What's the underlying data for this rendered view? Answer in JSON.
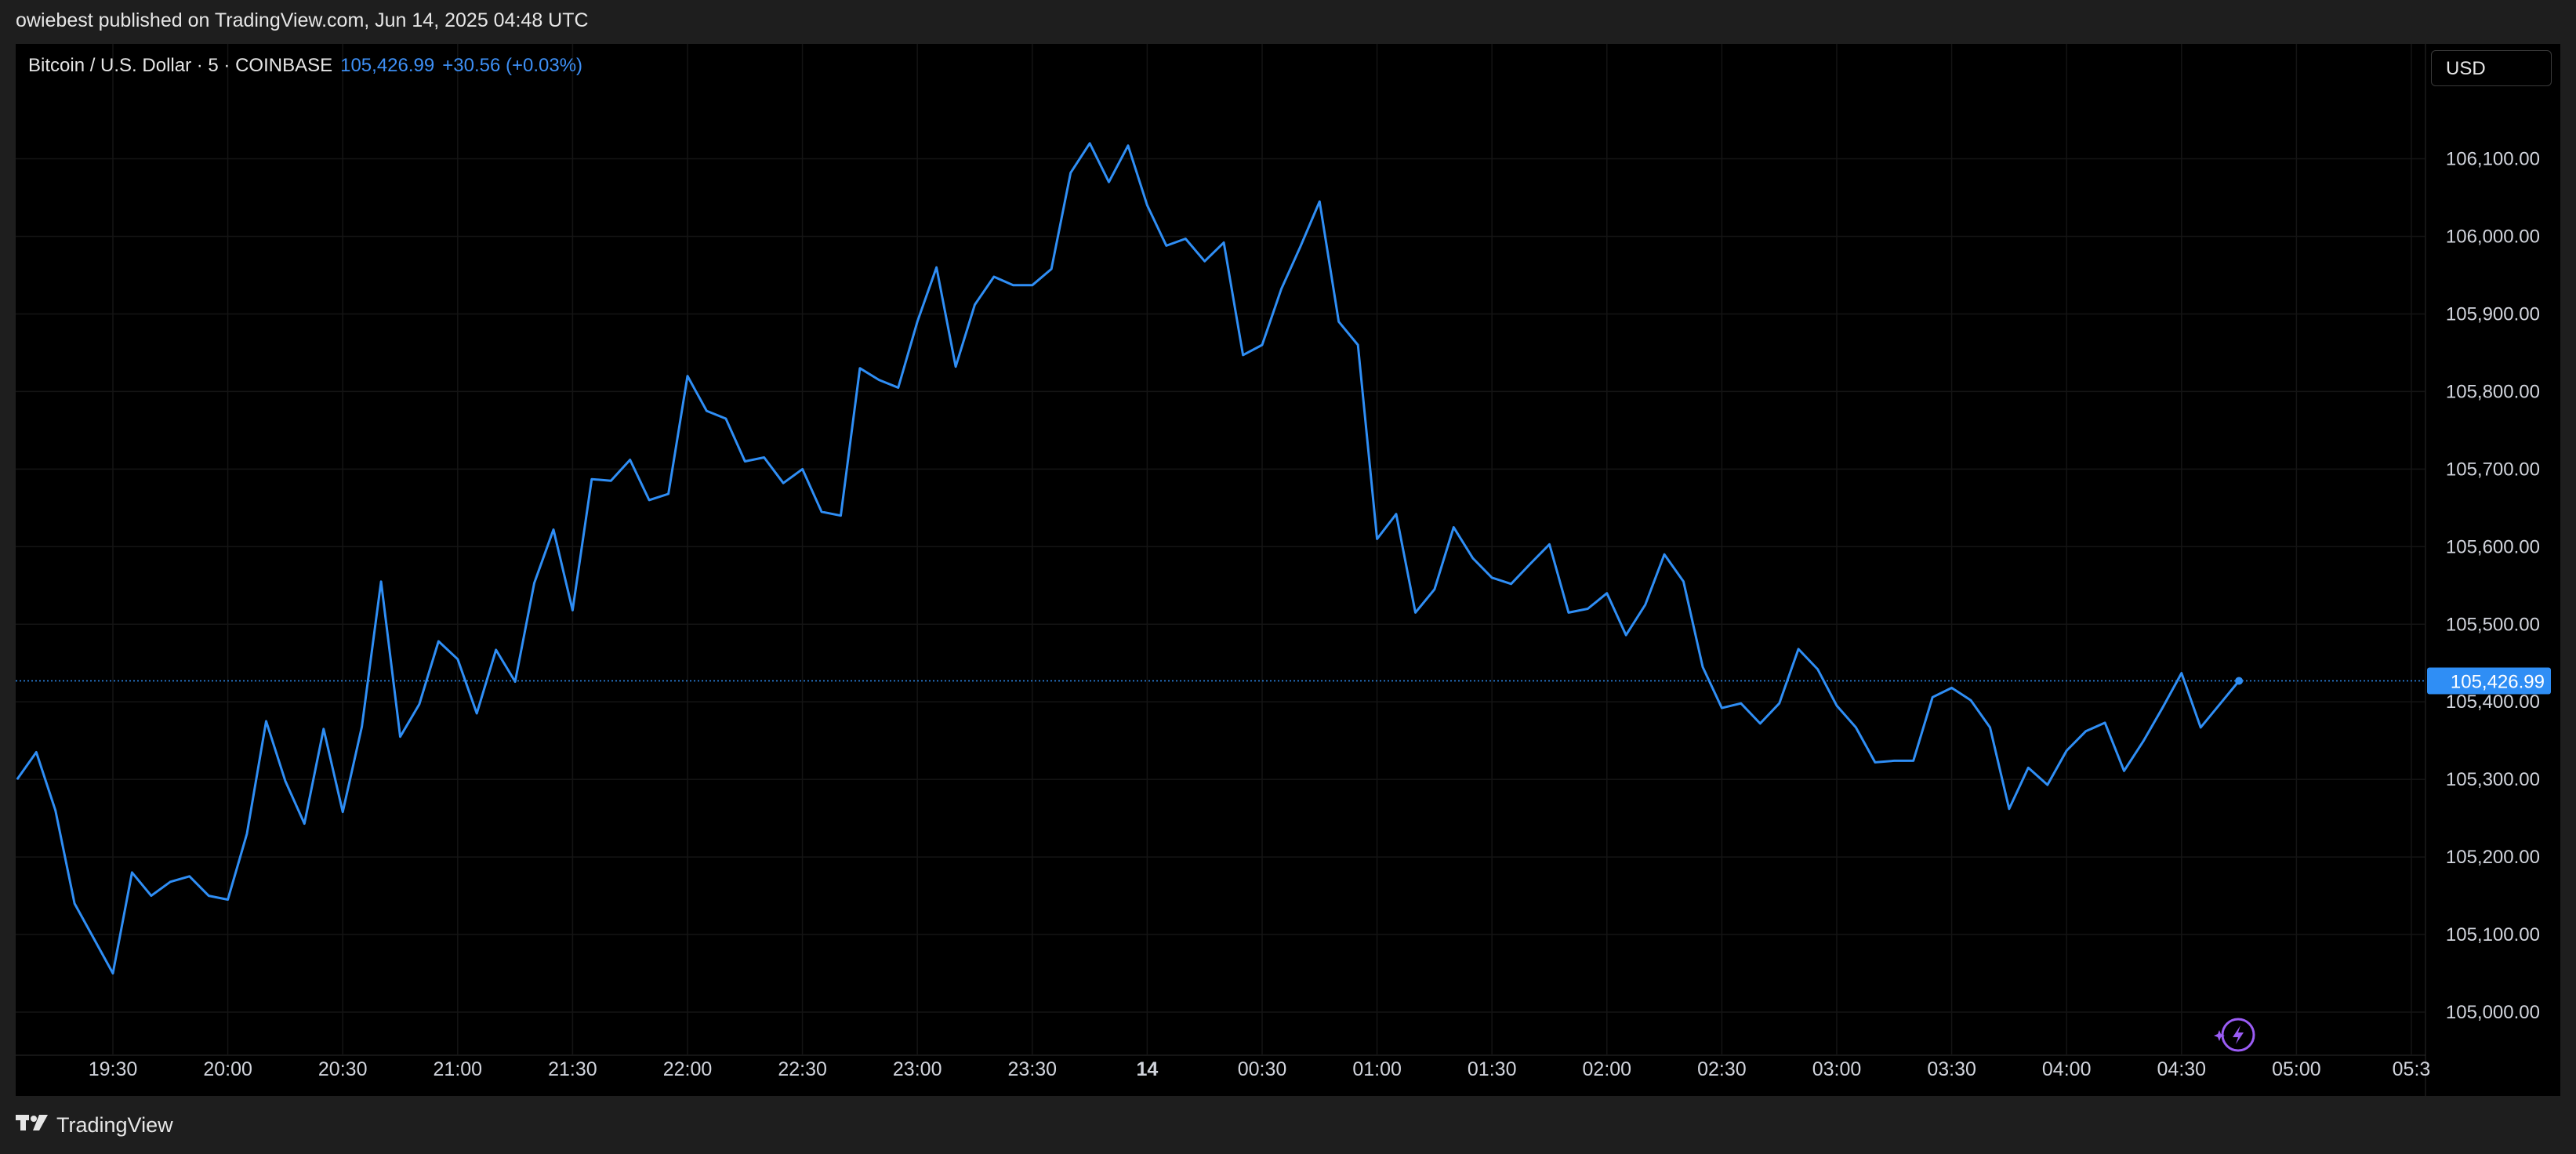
{
  "header": {
    "published_text": "owiebest published on TradingView.com, Jun 14, 2025 04:48 UTC"
  },
  "symbol": {
    "name": "Bitcoin / U.S. Dollar · 5 · COINBASE",
    "last_price": "105,426.99",
    "change": "+30.56 (+0.03%)"
  },
  "currency_button": {
    "label": "USD"
  },
  "footer": {
    "brand": "TradingView",
    "logo_icon": "tradingview-logo-icon"
  },
  "colors": {
    "line": "#2f8ef5",
    "background": "#000000",
    "frame": "#1e1e1e",
    "grid": "#141414",
    "price_label_bg": "#2f8ef5",
    "lightning_icon": "#9b5cf5"
  },
  "chart_data": {
    "type": "line",
    "title": "",
    "xlabel": "",
    "ylabel": "",
    "x_tick_labels": [
      "19:30",
      "20:00",
      "20:30",
      "21:00",
      "21:30",
      "22:00",
      "22:30",
      "23:00",
      "23:30",
      "14",
      "00:30",
      "01:00",
      "01:30",
      "02:00",
      "02:30",
      "03:00",
      "03:30",
      "04:00",
      "04:30",
      "05:00",
      "05:3"
    ],
    "y_tick_labels": [
      "106,100.00",
      "106,000.00",
      "105,900.00",
      "105,800.00",
      "105,700.00",
      "105,600.00",
      "105,500.00",
      "105,400.00",
      "105,300.00",
      "105,200.00",
      "105,100.00",
      "105,000.00"
    ],
    "y_ticks": [
      106100,
      106000,
      105900,
      105800,
      105700,
      105600,
      105500,
      105400,
      105300,
      105200,
      105100,
      105000
    ],
    "grid": true,
    "last_price_label": "105,426.99",
    "last_price_value": 105426.99,
    "series": [
      {
        "x_start": "19:05",
        "x_step_minutes": 5,
        "values": [
          105300,
          105335,
          105260,
          105140,
          105095,
          105050,
          105180,
          105150,
          105168,
          105175,
          105150,
          105145,
          105230,
          105375,
          105298,
          105243,
          105365,
          105258,
          105368,
          105555,
          105355,
          105397,
          105478,
          105455,
          105385,
          105467,
          105426,
          105553,
          105622,
          105518,
          105687,
          105685,
          105712,
          105660,
          105668,
          105820,
          105775,
          105765,
          105710,
          105715,
          105682,
          105700,
          105645,
          105640,
          105830,
          105815,
          105805,
          105890,
          105960,
          105832,
          105912,
          105948,
          105937,
          105937,
          105958,
          106082,
          106120,
          106070,
          106117,
          106040,
          105988,
          105997,
          105968,
          105992,
          105847,
          105860,
          105932,
          105987,
          106045,
          105890,
          105860,
          105610,
          105642,
          105515,
          105545,
          105625,
          105585,
          105560,
          105552,
          105578,
          105603,
          105515,
          105520,
          105540,
          105486,
          105525,
          105590,
          105555,
          105445,
          105392,
          105398,
          105372,
          105398,
          105468,
          105442,
          105395,
          105367,
          105322,
          105324,
          105324,
          105406,
          105418,
          105402,
          105367,
          105262,
          105315,
          105293,
          105337,
          105362,
          105373,
          105311,
          105349,
          105392,
          105437,
          105367,
          105397,
          105427
        ]
      }
    ]
  }
}
